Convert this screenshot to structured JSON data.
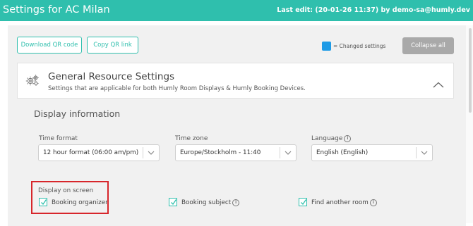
{
  "header": {
    "title": "Settings for AC Milan",
    "last_edit": "Last edit: (20-01-26 11:37) by demo-sa@humly.dev"
  },
  "toolbar": {
    "download_qr": "Download QR code",
    "copy_qr": "Copy QR link",
    "legend_text": "= Changed settings",
    "legend_color": "#1e9be6",
    "collapse_all": "Collapse all"
  },
  "section": {
    "icon": "gears-icon",
    "title": "General Resource Settings",
    "subtitle": "Settings that are applicable for both Humly Room Displays & Humly Booking Devices.",
    "toggle_icon": "chevron-up-icon"
  },
  "display_info": {
    "heading": "Display information",
    "fields": [
      {
        "label": "Time format",
        "value": "12 hour format (06:00 am/pm)"
      },
      {
        "label": "Time zone",
        "value": "Europe/Stockholm - 11:40"
      },
      {
        "label": "Language",
        "value": "English (English)"
      }
    ],
    "display_on_screen": {
      "label": "Display on screen",
      "options": [
        {
          "label": "Booking organizer",
          "checked": true
        },
        {
          "label": "Booking subject",
          "checked": true
        },
        {
          "label": "Find another room",
          "checked": true
        }
      ]
    }
  },
  "colors": {
    "accent": "#2fbfad",
    "highlight": "#d7262b"
  }
}
